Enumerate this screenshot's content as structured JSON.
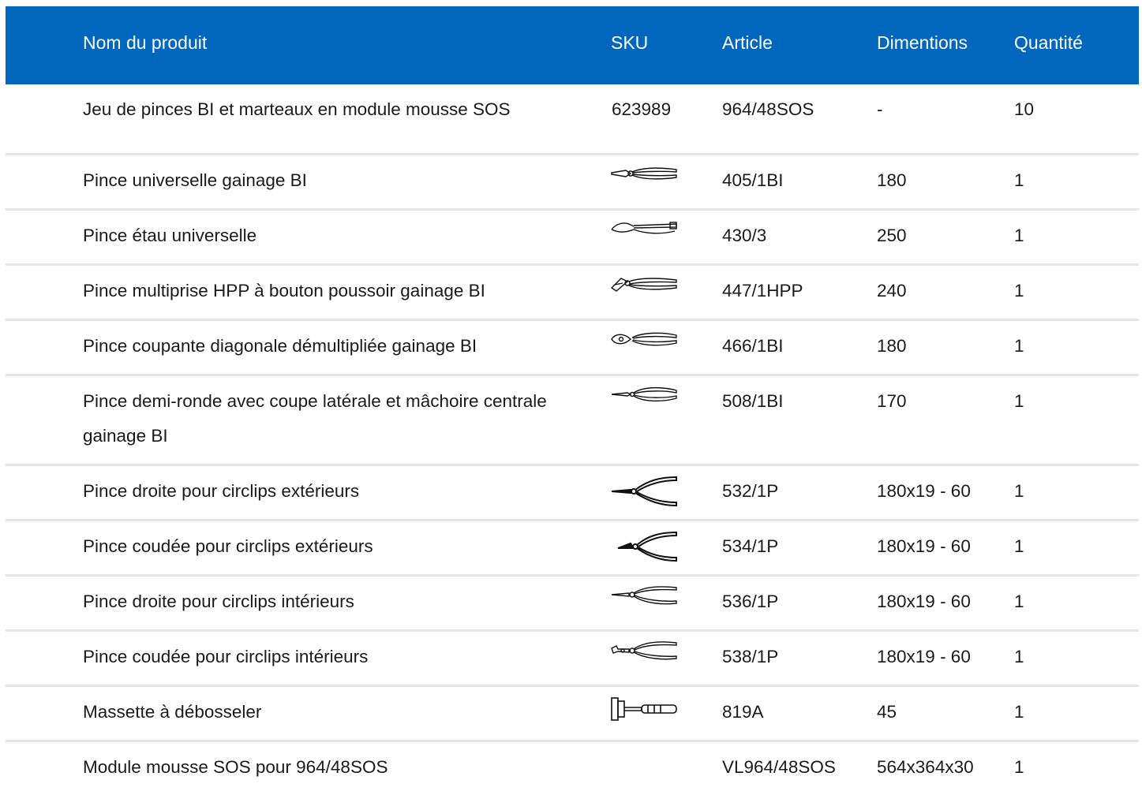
{
  "colors": {
    "header_bg": "#0067bd",
    "header_text": "#ffffff",
    "row_divider": "#e6e6e6"
  },
  "columns": {
    "name": "Nom du produit",
    "sku": "SKU",
    "article": "Article",
    "dimensions": "Dimentions",
    "quantity": "Quantité"
  },
  "rows": [
    {
      "name": "Jeu de pinces BI et marteaux en module mousse SOS",
      "sku": "623989",
      "article": "964/48SOS",
      "dimensions": "-",
      "quantity": "10"
    },
    {
      "name": "Pince universelle gainage BI",
      "sku_icon": "combination-pliers-icon",
      "article": "405/1BI",
      "dimensions": "180",
      "quantity": "1"
    },
    {
      "name": "Pince étau universelle",
      "sku_icon": "locking-pliers-icon",
      "article": "430/3",
      "dimensions": "250",
      "quantity": "1"
    },
    {
      "name": "Pince multiprise HPP à bouton poussoir gainage BI",
      "sku_icon": "slip-joint-pliers-icon",
      "article": "447/1HPP",
      "dimensions": "240",
      "quantity": "1"
    },
    {
      "name": "Pince coupante diagonale démultipliée gainage BI",
      "sku_icon": "diagonal-cutter-icon",
      "article": "466/1BI",
      "dimensions": "180",
      "quantity": "1"
    },
    {
      "name": "Pince demi-ronde avec coupe latérale et mâchoire centrale gainage BI",
      "sku_icon": "half-round-pliers-icon",
      "article": "508/1BI",
      "dimensions": "170",
      "quantity": "1"
    },
    {
      "name": "Pince droite pour circlips extérieurs",
      "sku_icon": "straight-external-circlip-pliers-icon",
      "article": "532/1P",
      "dimensions": "180x19 - 60",
      "quantity": "1"
    },
    {
      "name": "Pince coudée pour circlips extérieurs",
      "sku_icon": "bent-external-circlip-pliers-icon",
      "article": "534/1P",
      "dimensions": "180x19 - 60",
      "quantity": "1"
    },
    {
      "name": "Pince droite pour circlips intérieurs",
      "sku_icon": "straight-internal-circlip-pliers-icon",
      "article": "536/1P",
      "dimensions": "180x19 - 60",
      "quantity": "1"
    },
    {
      "name": "Pince coudée pour circlips intérieurs",
      "sku_icon": "bent-internal-circlip-pliers-icon",
      "article": "538/1P",
      "dimensions": "180x19 - 60",
      "quantity": "1"
    },
    {
      "name": "Massette à débosseler",
      "sku_icon": "dead-blow-mallet-icon",
      "article": "819A",
      "dimensions": "45",
      "quantity": "1"
    },
    {
      "name": "Module mousse SOS pour 964/48SOS",
      "article": "VL964/48SOS",
      "dimensions": "564x364x30",
      "quantity": "1"
    }
  ]
}
